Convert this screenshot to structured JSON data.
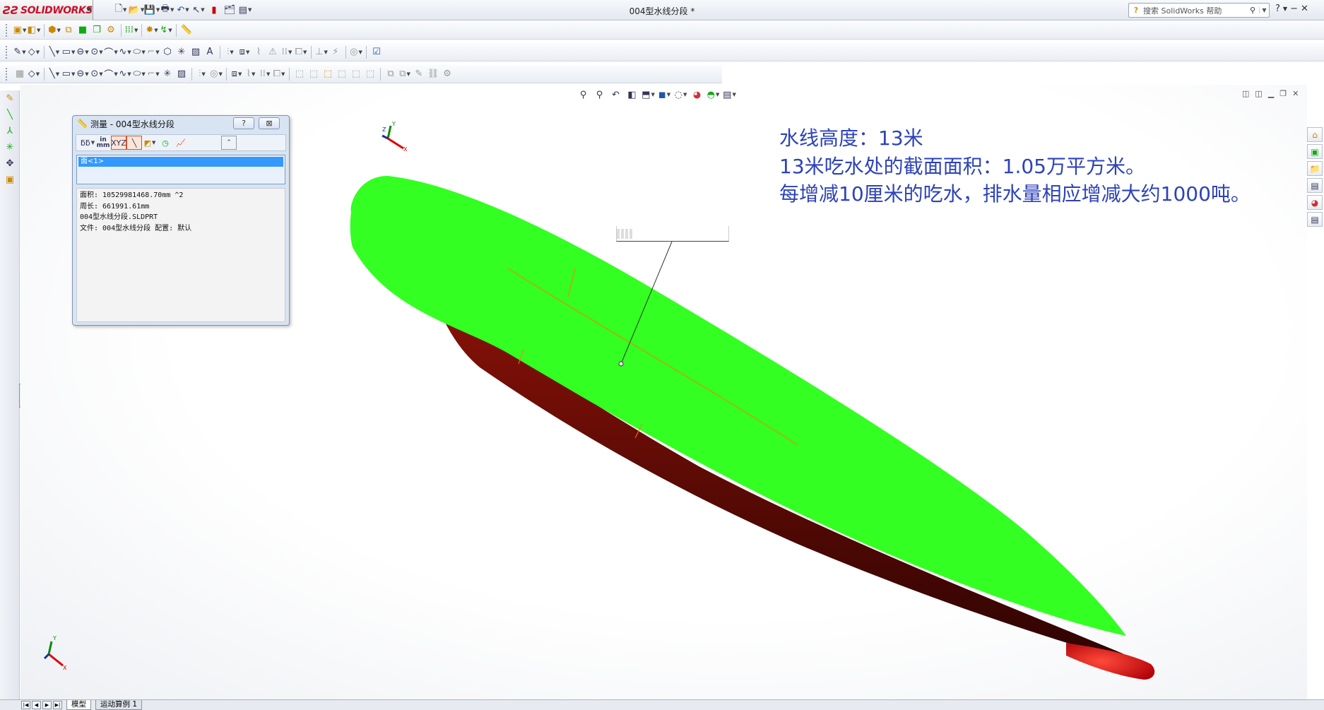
{
  "app": {
    "logo_text": "SOLIDWORKS",
    "window_title": "004型水线分段 *",
    "help_search_placeholder": "搜索 SolidWorks 帮助",
    "help_icon": "?"
  },
  "annotation": {
    "line1": "水线高度：13米",
    "line2": "13米吃水处的截面面积：1.05万平方米。",
    "line3": "每增减10厘米的吃水，排水量相应增减大约1000吨。",
    "color": "#2d43b8"
  },
  "measure_dialog": {
    "title": "测量 - 004型水线分段",
    "help_btn": "?",
    "close_btn": "⊠",
    "unit_label_top": "in",
    "unit_label_bottom": "mm",
    "selection": "面<1>",
    "results": [
      "面积: 10529981468.70mm ^2",
      "周长: 661991.61mm",
      "004型水线分段.SLDPRT",
      "文件:  004型水线分段 配置:  默认"
    ]
  },
  "colors": {
    "deck": "#33ff22",
    "hull": "#5c0a06",
    "bow": "#e0141a"
  },
  "status": {
    "tab_model": "模型",
    "tab_motion": "运动算例 1"
  },
  "triad": {
    "x_label": "X",
    "y_label": "Y",
    "z_label": "Z"
  }
}
